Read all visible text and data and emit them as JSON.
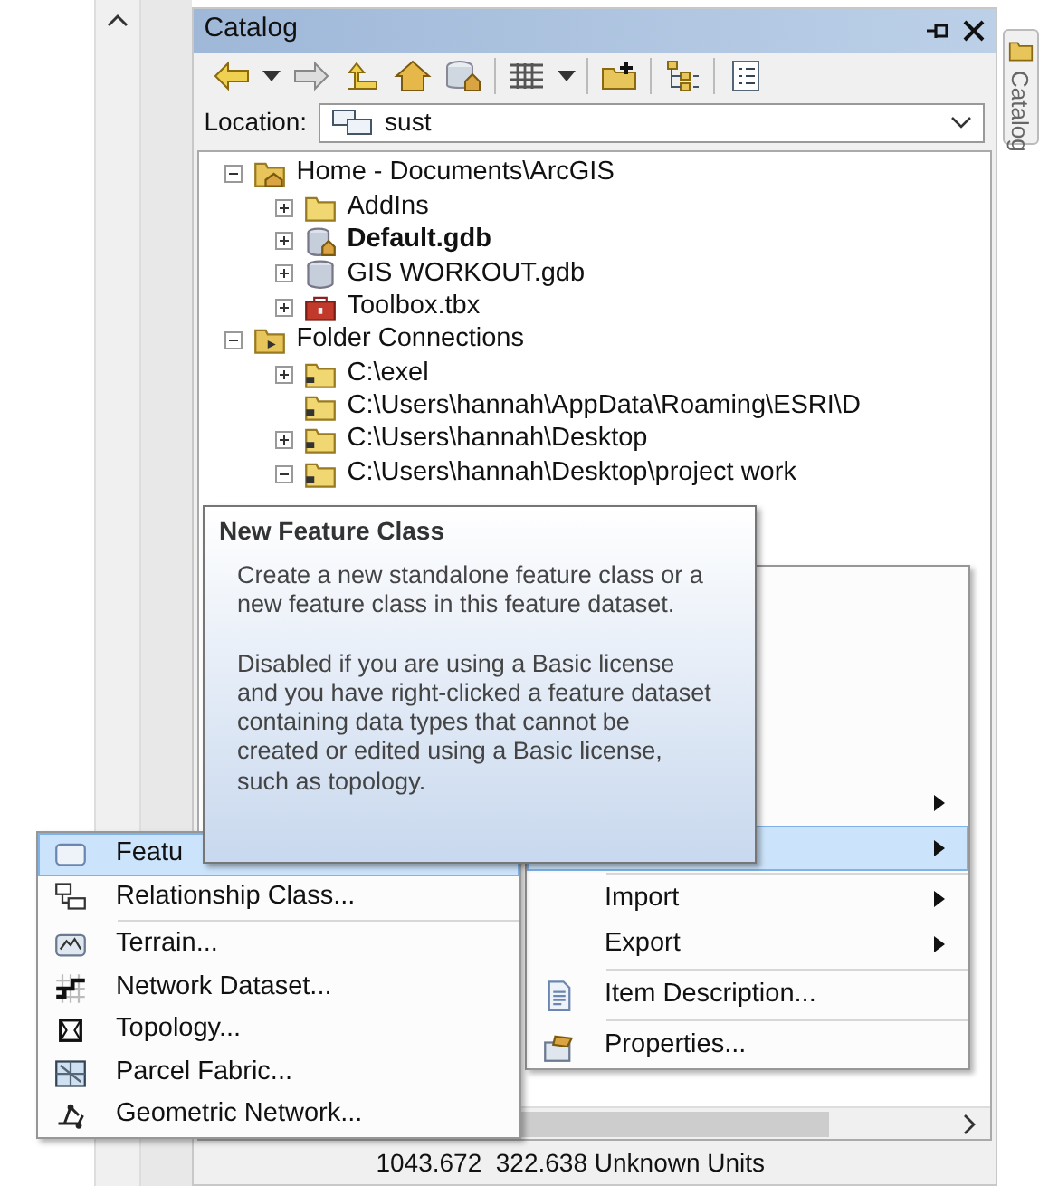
{
  "catalog_window": {
    "title": "Catalog",
    "location_label": "Location:",
    "location_value": "sust"
  },
  "side_tab": {
    "label": "Catalog"
  },
  "tree": [
    {
      "label": "Home - Documents\\ArcGIS",
      "kind": "home-folder",
      "expanded": true,
      "children": [
        {
          "label": "AddIns",
          "kind": "folder",
          "expanded": false
        },
        {
          "label": "Default.gdb",
          "kind": "home-geodatabase",
          "expanded": false,
          "bold": true
        },
        {
          "label": "GIS WORKOUT.gdb",
          "kind": "geodatabase",
          "expanded": false
        },
        {
          "label": "Toolbox.tbx",
          "kind": "toolbox",
          "expanded": false
        }
      ]
    },
    {
      "label": "Folder Connections",
      "kind": "connections-folder",
      "expanded": true,
      "children": [
        {
          "label": "C:\\exel",
          "kind": "connected-folder",
          "expanded": false
        },
        {
          "label": "C:\\Users\\hannah\\AppData\\Roaming\\ESRI\\D",
          "kind": "connected-folder"
        },
        {
          "label": "C:\\Users\\hannah\\Desktop",
          "kind": "connected-folder",
          "expanded": false
        },
        {
          "label": "C:\\Users\\hannah\\Desktop\\project work",
          "kind": "connected-folder",
          "expanded": true
        }
      ]
    }
  ],
  "context_menu": [
    {
      "kind": "item",
      "submenu": true,
      "selected": false
    },
    {
      "kind": "item",
      "submenu": true,
      "selected": true
    },
    {
      "kind": "separator"
    },
    {
      "kind": "item",
      "label": "Import",
      "submenu": true,
      "selected": false
    },
    {
      "kind": "item",
      "label": "Export",
      "submenu": true,
      "selected": false
    },
    {
      "kind": "separator"
    },
    {
      "kind": "item",
      "label": "Item Description...",
      "submenu": false,
      "selected": false
    },
    {
      "kind": "separator"
    },
    {
      "kind": "item",
      "label": "Properties...",
      "submenu": false,
      "selected": false
    }
  ],
  "submenu": [
    {
      "kind": "item",
      "label": "Featu",
      "selected": true
    },
    {
      "kind": "item",
      "label": "Relationship Class...",
      "selected": false
    },
    {
      "kind": "separator"
    },
    {
      "kind": "item",
      "label": "Terrain...",
      "selected": false
    },
    {
      "kind": "item",
      "label": "Network Dataset...",
      "selected": false
    },
    {
      "kind": "item",
      "label": "Topology...",
      "selected": false
    },
    {
      "kind": "item",
      "label": "Parcel Fabric...",
      "selected": false
    },
    {
      "kind": "item",
      "label": "Geometric Network...",
      "selected": false
    }
  ],
  "tooltip": {
    "title": "New Feature Class",
    "paragraphs": [
      "Create a new standalone feature class or a new feature class in this feature dataset.",
      "Disabled if you are using a Basic license and you have right-clicked a feature dataset containing data types that cannot be created or edited using a Basic license, such as topology."
    ]
  },
  "status_bar": {
    "coordinates": "1043.672  322.638 Unknown Units"
  }
}
